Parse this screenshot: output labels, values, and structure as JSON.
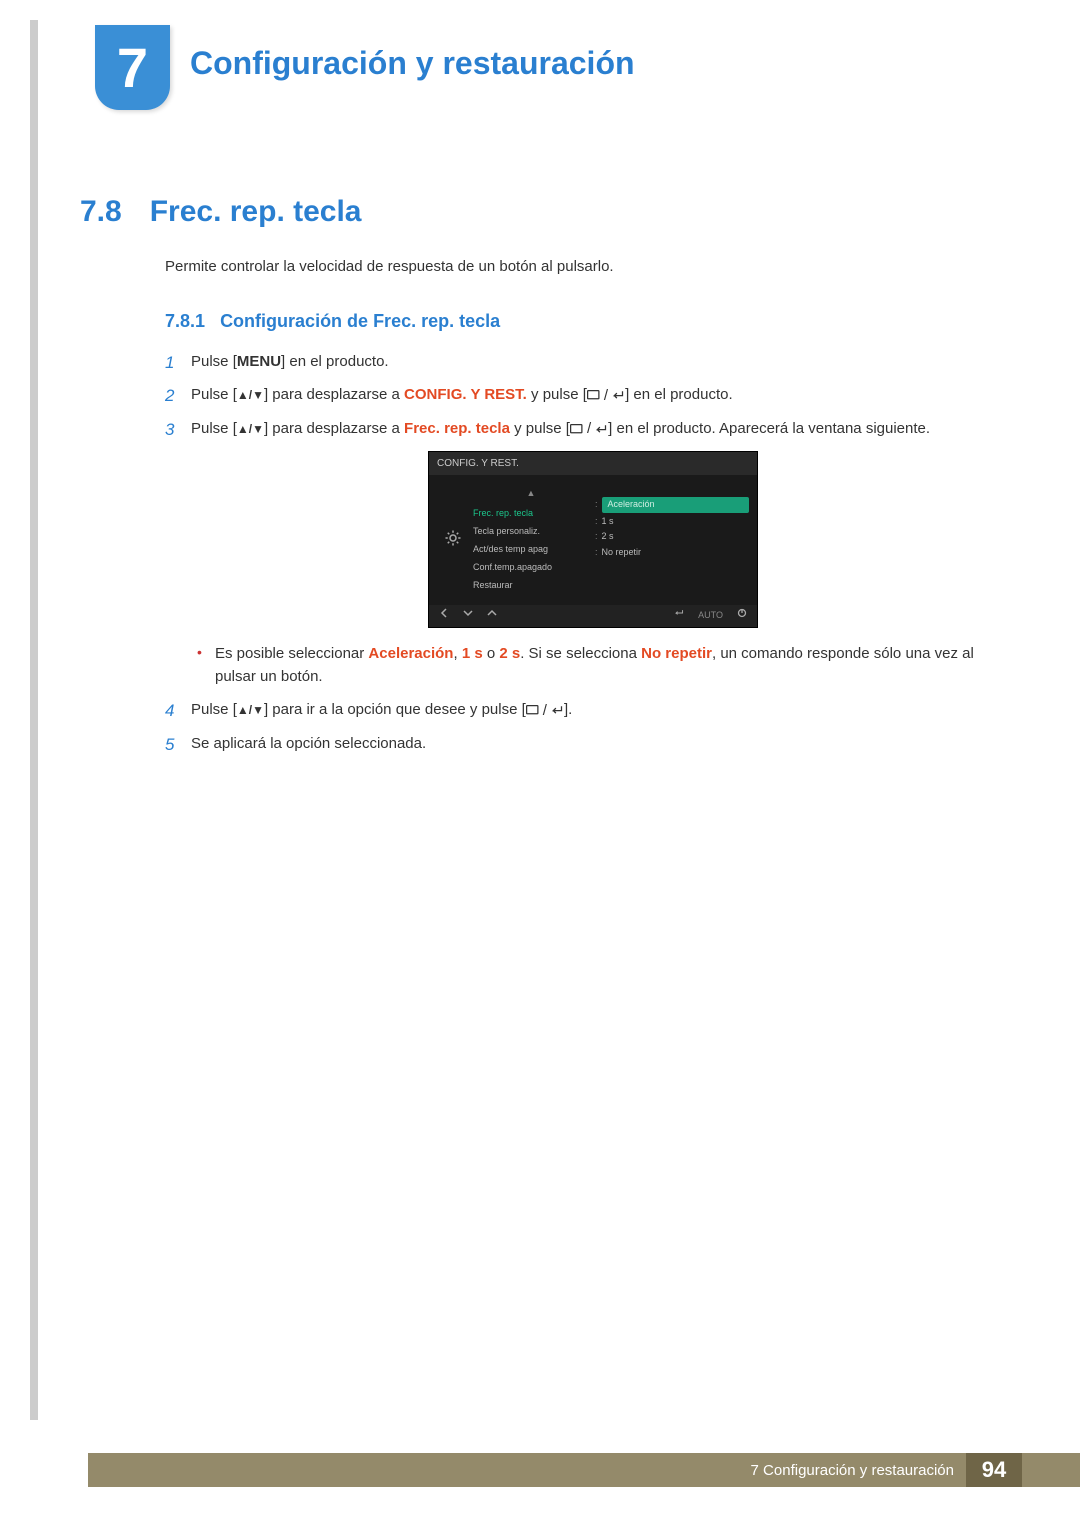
{
  "chapter": {
    "number": "7",
    "title": "Configuración y restauración"
  },
  "section": {
    "number": "7.8",
    "title": "Frec. rep. tecla"
  },
  "intro": "Permite controlar la velocidad de respuesta de un botón al pulsarlo.",
  "subsection": {
    "number": "7.8.1",
    "title": "Configuración de Frec. rep. tecla"
  },
  "labels": {
    "menu": "MENU",
    "updown": "▲/▼"
  },
  "steps": {
    "s1_a": "Pulse [",
    "s1_b": "] en el producto.",
    "s2_a": "Pulse [",
    "s2_b": "] para desplazarse a ",
    "s2_c": "CONFIG. Y REST.",
    "s2_d": " y pulse [",
    "s2_e": "] en el producto.",
    "s3_a": "Pulse [",
    "s3_b": "] para desplazarse a ",
    "s3_c": "Frec. rep. tecla",
    "s3_d": " y pulse [",
    "s3_e": "] en el producto. Aparecerá la ventana siguiente.",
    "bullet_a": "Es posible seleccionar ",
    "bullet_b": "Aceleración",
    "bullet_c": ", ",
    "bullet_d": "1 s",
    "bullet_e": " o ",
    "bullet_f": "2 s",
    "bullet_g": ". Si se selecciona ",
    "bullet_h": "No repetir",
    "bullet_i": ", un comando responde sólo una vez al pulsar un botón.",
    "s4_a": "Pulse [",
    "s4_b": "] para ir a la opción que desee y pulse [",
    "s4_c": "].",
    "s5": "Se aplicará la opción seleccionada."
  },
  "osd": {
    "title": "CONFIG. Y REST.",
    "items": [
      "Frec. rep. tecla",
      "Tecla personaliz.",
      "Act/des temp apag",
      "Conf.temp.apagado",
      "Restaurar"
    ],
    "values": [
      "Aceleración",
      "1 s",
      "2 s",
      "No repetir"
    ],
    "footer_auto": "AUTO"
  },
  "footer": {
    "text": "7 Configuración y restauración",
    "page": "94"
  }
}
